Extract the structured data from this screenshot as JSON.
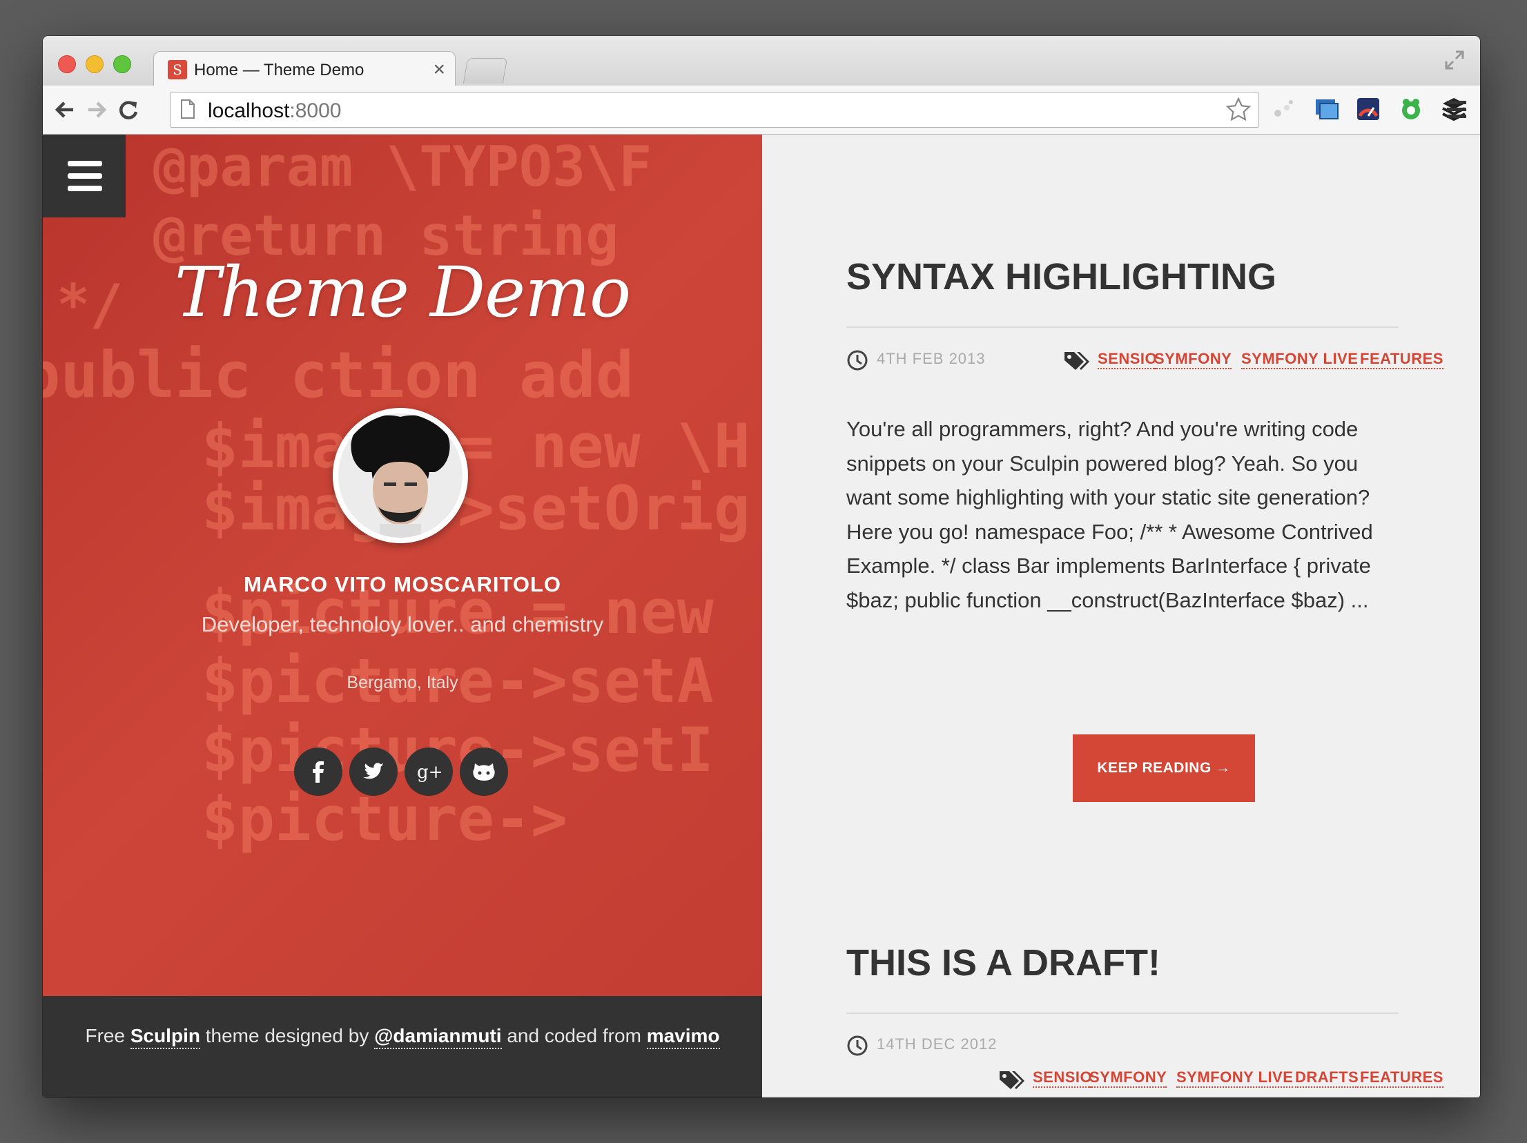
{
  "browser": {
    "tab_title": "Home — Theme Demo",
    "tab_close": "×",
    "favicon_letter": "S",
    "url_host": "localhost",
    "url_port": ":8000"
  },
  "sidebar": {
    "site_title": "Theme Demo",
    "author_name": "MARCO VITO MOSCARITOLO",
    "bio": "Developer, technoloy lover.. and chemistry",
    "location": "Bergamo, Italy",
    "social": [
      "facebook",
      "twitter",
      "google-plus",
      "github"
    ]
  },
  "footer": {
    "p1": "Free ",
    "link1": "Sculpin",
    "p2": " theme designed by ",
    "link2": "@damianmuti",
    "p3": " and coded from ",
    "link3": "mavimo"
  },
  "posts": [
    {
      "title": "SYNTAX HIGHLIGHTING",
      "date": "4TH FEB 2013",
      "tags": [
        "SENSIO",
        "SYMFONY",
        "SYMFONY LIVE",
        "FEATURES"
      ],
      "excerpt": "You're all programmers, right? And you're writing code snippets on your Sculpin powered blog? Yeah. So you want some highlighting with your static site generation? Here you go! namespace Foo; /** * Awesome Contrived Example. */ class Bar implements BarInterface { private $baz; public function __construct(BazInterface $baz) ...",
      "button": "KEEP READING →"
    },
    {
      "title": "THIS IS A DRAFT!",
      "date": "14TH DEC 2012",
      "tags": [
        "SENSIO",
        "SYMFONY",
        "SYMFONY LIVE",
        "DRAFTS",
        "FEATURES"
      ]
    }
  ],
  "colors": {
    "accent": "#d44636",
    "sidebar": "#c9443a",
    "dark": "#333333"
  }
}
